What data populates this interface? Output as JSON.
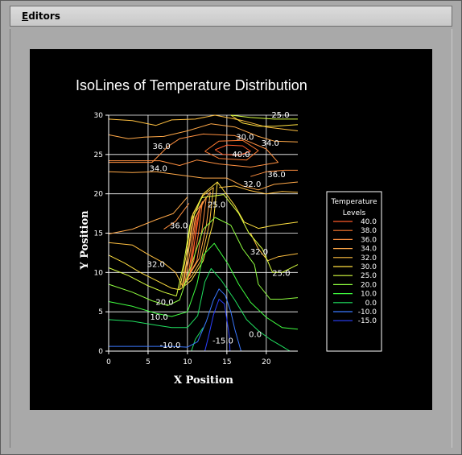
{
  "menubar": {
    "editors_label": "Editors"
  },
  "chart_data": {
    "type": "contour",
    "title": "IsoLines of Temperature Distribution",
    "xlabel": "X Position",
    "ylabel": "Y Position",
    "xlim": [
      0,
      24
    ],
    "ylim": [
      0,
      30
    ],
    "x_ticks": [
      "0",
      "5",
      "10",
      "15",
      "20"
    ],
    "y_ticks": [
      "0",
      "5",
      "10",
      "15",
      "20",
      "25",
      "30"
    ],
    "grid": true,
    "legend": {
      "title_line1": "Temperature",
      "title_line2": "Levels",
      "placement": "right",
      "levels": [
        {
          "label": "40.0",
          "color": "#ff5a28"
        },
        {
          "label": "38.0",
          "color": "#ff7a30"
        },
        {
          "label": "36.0",
          "color": "#ff9040"
        },
        {
          "label": "34.0",
          "color": "#ffa848"
        },
        {
          "label": "32.0",
          "color": "#ffc040"
        },
        {
          "label": "30.0",
          "color": "#ffe040"
        },
        {
          "label": "25.0",
          "color": "#d8ff40"
        },
        {
          "label": "20.0",
          "color": "#90ff40"
        },
        {
          "label": "10.0",
          "color": "#40ff40"
        },
        {
          "label": "0.0",
          "color": "#20e060"
        },
        {
          "label": "-10.0",
          "color": "#3a78ff"
        },
        {
          "label": "-15.0",
          "color": "#2a40ff"
        }
      ]
    },
    "contour_labels": [
      {
        "text": "25.0",
        "x": 21.8,
        "y": 30.0,
        "level": "25.0"
      },
      {
        "text": "30.0",
        "x": 17.3,
        "y": 27.2,
        "level": "30.0"
      },
      {
        "text": "34.0",
        "x": 20.5,
        "y": 26.4,
        "level": "34.0"
      },
      {
        "text": "36.0",
        "x": 6.7,
        "y": 26.0,
        "level": "36.0"
      },
      {
        "text": "40.0",
        "x": 16.8,
        "y": 25.0,
        "level": "40.0"
      },
      {
        "text": "34.0",
        "x": 6.3,
        "y": 23.2,
        "level": "34.0"
      },
      {
        "text": "36.0",
        "x": 21.3,
        "y": 22.4,
        "level": "36.0"
      },
      {
        "text": "32.0",
        "x": 18.2,
        "y": 21.2,
        "level": "32.0"
      },
      {
        "text": "25.0",
        "x": 13.7,
        "y": 18.6,
        "level": "25.0"
      },
      {
        "text": "36.0",
        "x": 8.9,
        "y": 15.9,
        "level": "36.0"
      },
      {
        "text": "32.0",
        "x": 19.1,
        "y": 12.6,
        "level": "32.0"
      },
      {
        "text": "32.0",
        "x": 6.0,
        "y": 11.0,
        "level": "32.0"
      },
      {
        "text": "25.0",
        "x": 21.9,
        "y": 9.9,
        "level": "25.0"
      },
      {
        "text": "20.0",
        "x": 7.1,
        "y": 6.2,
        "level": "20.0"
      },
      {
        "text": "10.0",
        "x": 6.4,
        "y": 4.3,
        "level": "10.0"
      },
      {
        "text": "-15.0",
        "x": 14.5,
        "y": 1.3,
        "level": "-15.0"
      },
      {
        "text": "0.0",
        "x": 18.6,
        "y": 2.1,
        "level": "0.0"
      },
      {
        "text": "-10.0",
        "x": 7.8,
        "y": 0.7,
        "level": "-10.0"
      }
    ],
    "contours": [
      {
        "level": "40.0",
        "points": [
          [
            10.3,
            9.5
          ],
          [
            10.8,
            13
          ],
          [
            11.2,
            16.5
          ],
          [
            11.6,
            18.2
          ],
          [
            11.0,
            14.5
          ],
          [
            10.5,
            11.5
          ],
          [
            10.3,
            9.5
          ]
        ]
      },
      {
        "level": "40.0",
        "points": [
          [
            13.5,
            25.6
          ],
          [
            15,
            26.2
          ],
          [
            17,
            26.1
          ],
          [
            18,
            25.4
          ],
          [
            16.5,
            24.9
          ],
          [
            14.5,
            25.0
          ],
          [
            13.5,
            25.6
          ]
        ]
      },
      {
        "level": "38.0",
        "points": [
          [
            10.0,
            9.0
          ],
          [
            10.6,
            13
          ],
          [
            11.1,
            17
          ],
          [
            11.9,
            19
          ],
          [
            11.4,
            15
          ],
          [
            10.8,
            11.5
          ],
          [
            10.0,
            9.0
          ]
        ]
      },
      {
        "level": "38.0",
        "points": [
          [
            12.2,
            25.4
          ],
          [
            14,
            26.7
          ],
          [
            17,
            26.8
          ],
          [
            19,
            25.5
          ],
          [
            17.5,
            24.3
          ],
          [
            14,
            24.5
          ],
          [
            12.2,
            25.4
          ]
        ]
      },
      {
        "level": "36.0",
        "points": [
          [
            9.7,
            8.8
          ],
          [
            10.4,
            13
          ],
          [
            11.0,
            17
          ],
          [
            12.4,
            19.6
          ],
          [
            11.9,
            15.8
          ],
          [
            11.2,
            11.5
          ],
          [
            9.7,
            8.8
          ]
        ]
      },
      {
        "level": "36.0",
        "points": [
          [
            0,
            24.0
          ],
          [
            3,
            24.0
          ],
          [
            5.5,
            24.0
          ],
          [
            7.5,
            26.0
          ],
          [
            9,
            27.0
          ],
          [
            12,
            27.6
          ],
          [
            16,
            27.4
          ],
          [
            20,
            25.7
          ],
          [
            21.5,
            24
          ],
          [
            18,
            23.4
          ],
          [
            14,
            23.8
          ],
          [
            11.2,
            24.3
          ],
          [
            9,
            23.6
          ],
          [
            6.5,
            24.2
          ],
          [
            3,
            24.2
          ],
          [
            0,
            24.2
          ]
        ]
      },
      {
        "level": "36.0",
        "points": [
          [
            7,
            15.5
          ],
          [
            8.5,
            16.5
          ],
          [
            10.2,
            18.8
          ]
        ]
      },
      {
        "level": "36.0",
        "points": [
          [
            18,
            22.2
          ],
          [
            20,
            22.8
          ],
          [
            22.3,
            23.0
          ],
          [
            24,
            23.0
          ]
        ]
      },
      {
        "level": "34.0",
        "points": [
          [
            9.5,
            8.4
          ],
          [
            10.1,
            12.5
          ],
          [
            10.9,
            17.5
          ],
          [
            12.9,
            20.2
          ],
          [
            12.4,
            16
          ],
          [
            11.5,
            11.8
          ],
          [
            9.5,
            8.4
          ]
        ]
      },
      {
        "level": "34.0",
        "points": [
          [
            0,
            27.5
          ],
          [
            2.5,
            27.0
          ],
          [
            4.5,
            27.2
          ],
          [
            7,
            27.3
          ],
          [
            10,
            28.0
          ],
          [
            13,
            28.9
          ],
          [
            16,
            28.5
          ],
          [
            19,
            27.3
          ],
          [
            21,
            26.7
          ],
          [
            24,
            26.6
          ]
        ]
      },
      {
        "level": "34.0",
        "points": [
          [
            0,
            22.8
          ],
          [
            3,
            22.7
          ],
          [
            6,
            22.8
          ],
          [
            9,
            22.4
          ],
          [
            12,
            22.0
          ],
          [
            15,
            22.0
          ],
          [
            17,
            21.0
          ],
          [
            19,
            20.5
          ],
          [
            21,
            21.2
          ],
          [
            24,
            21.5
          ]
        ]
      },
      {
        "level": "34.0",
        "points": [
          [
            0,
            14.9
          ],
          [
            3,
            15.5
          ],
          [
            6,
            16.7
          ],
          [
            8.2,
            17.5
          ],
          [
            10,
            19.6
          ]
        ]
      },
      {
        "level": "32.0",
        "points": [
          [
            9.3,
            8.2
          ],
          [
            10.0,
            12
          ],
          [
            10.7,
            17.5
          ],
          [
            12.0,
            19.8
          ],
          [
            13.3,
            20.8
          ],
          [
            12.8,
            16.2
          ],
          [
            11.7,
            11.5
          ],
          [
            10.5,
            9.5
          ],
          [
            9.3,
            8.2
          ]
        ]
      },
      {
        "level": "32.0",
        "points": [
          [
            0,
            29.5
          ],
          [
            3,
            29.3
          ],
          [
            6,
            28.7
          ],
          [
            8,
            29.4
          ],
          [
            11,
            29.5
          ],
          [
            13.5,
            30.0
          ],
          [
            17,
            29.3
          ],
          [
            20,
            28.5
          ],
          [
            24,
            28.0
          ]
        ]
      },
      {
        "level": "32.0",
        "points": [
          [
            14,
            20.8
          ],
          [
            16,
            21.0
          ],
          [
            18,
            20.4
          ],
          [
            20,
            20.0
          ],
          [
            22,
            20.3
          ],
          [
            24,
            20.2
          ]
        ]
      },
      {
        "level": "32.0",
        "points": [
          [
            0,
            13.8
          ],
          [
            3,
            13.5
          ],
          [
            5,
            12.3
          ],
          [
            7,
            11.2
          ],
          [
            8.5,
            10.0
          ],
          [
            9.3,
            8.4
          ]
        ]
      },
      {
        "level": "32.0",
        "points": [
          [
            18,
            15.0
          ],
          [
            19,
            13.0
          ],
          [
            20.2,
            11.5
          ],
          [
            21.5,
            12.0
          ],
          [
            24,
            12.4
          ]
        ]
      },
      {
        "level": "30.0",
        "points": [
          [
            9.0,
            7.8
          ],
          [
            9.8,
            12
          ],
          [
            10.5,
            17
          ],
          [
            12,
            20
          ],
          [
            13.8,
            21.5
          ],
          [
            13.3,
            16.5
          ],
          [
            12.0,
            11.5
          ],
          [
            10.5,
            9
          ],
          [
            9.0,
            7.8
          ]
        ]
      },
      {
        "level": "30.0",
        "points": [
          [
            15.5,
            30
          ],
          [
            17,
            29.0
          ],
          [
            19,
            28.6
          ],
          [
            21,
            28.6
          ],
          [
            24,
            28.8
          ]
        ]
      },
      {
        "level": "30.0",
        "points": [
          [
            13.8,
            21.5
          ],
          [
            16,
            18.5
          ],
          [
            17.2,
            16.4
          ],
          [
            19,
            15.6
          ],
          [
            21,
            16.0
          ],
          [
            24,
            16.4
          ]
        ]
      },
      {
        "level": "30.0",
        "points": [
          [
            0,
            12.2
          ],
          [
            2,
            11.2
          ],
          [
            4,
            10.0
          ],
          [
            6,
            9.0
          ],
          [
            8,
            8.0
          ],
          [
            9.0,
            7.8
          ]
        ]
      },
      {
        "level": "25.0",
        "points": [
          [
            8.6,
            7.0
          ],
          [
            9.5,
            11
          ],
          [
            10.3,
            16
          ],
          [
            11.8,
            19.5
          ],
          [
            14.6,
            19.9
          ],
          [
            16.5,
            17.5
          ],
          [
            17.8,
            15.0
          ],
          [
            19.5,
            13.0
          ],
          [
            20.8,
            10.0
          ],
          [
            22,
            10.0
          ],
          [
            24,
            11.0
          ]
        ]
      },
      {
        "level": "25.0",
        "points": [
          [
            15.5,
            30
          ],
          [
            18,
            29.7
          ],
          [
            21,
            29.5
          ],
          [
            24,
            29.5
          ]
        ]
      },
      {
        "level": "25.0",
        "points": [
          [
            0,
            10.6
          ],
          [
            2.5,
            9.6
          ],
          [
            5,
            8.3
          ],
          [
            7,
            7.5
          ],
          [
            8.6,
            7.0
          ]
        ]
      },
      {
        "level": "20.0",
        "points": [
          [
            0,
            8.5
          ],
          [
            3,
            7.5
          ],
          [
            5.5,
            6.4
          ],
          [
            7.5,
            5.8
          ],
          [
            9,
            6.5
          ],
          [
            10.5,
            11
          ],
          [
            12,
            15.5
          ],
          [
            13.5,
            17.0
          ],
          [
            15.5,
            16.0
          ],
          [
            17,
            13.0
          ],
          [
            18.5,
            11.0
          ],
          [
            19,
            8.5
          ],
          [
            20.5,
            6.6
          ],
          [
            22,
            6.6
          ],
          [
            24,
            6.8
          ]
        ]
      },
      {
        "level": "10.0",
        "points": [
          [
            0,
            6.3
          ],
          [
            3,
            5.7
          ],
          [
            6,
            4.8
          ],
          [
            8,
            4.4
          ],
          [
            10,
            5.0
          ],
          [
            11.2,
            8.5
          ],
          [
            12,
            12.2
          ],
          [
            13.4,
            13.7
          ],
          [
            15.2,
            11.0
          ],
          [
            16.5,
            8.5
          ],
          [
            18,
            6.2
          ],
          [
            20,
            4.3
          ],
          [
            22,
            3.0
          ],
          [
            24,
            2.8
          ]
        ]
      },
      {
        "level": "0.0",
        "points": [
          [
            0,
            4.0
          ],
          [
            3,
            3.8
          ],
          [
            6,
            3.3
          ],
          [
            8,
            3.0
          ],
          [
            10,
            3.0
          ],
          [
            11.3,
            4.5
          ],
          [
            12.2,
            8.8
          ],
          [
            13.0,
            10.5
          ],
          [
            14.3,
            9.0
          ],
          [
            16,
            6.5
          ],
          [
            17.5,
            4.0
          ],
          [
            19,
            2.6
          ],
          [
            20.5,
            1.5
          ],
          [
            22,
            0.6
          ],
          [
            23,
            0
          ]
        ]
      },
      {
        "level": "0.0",
        "points": [
          [
            10.5,
            0
          ],
          [
            11,
            1.5
          ],
          [
            12,
            3.0
          ]
        ]
      },
      {
        "level": "-10.0",
        "points": [
          [
            0,
            0.6
          ],
          [
            3,
            0.6
          ],
          [
            6,
            0.6
          ],
          [
            8,
            0.6
          ],
          [
            10,
            0.5
          ],
          [
            11.3,
            1.2
          ],
          [
            12.4,
            3.8
          ],
          [
            13.3,
            6.5
          ],
          [
            14.0,
            7.9
          ],
          [
            14.8,
            7.1
          ],
          [
            15.5,
            5.0
          ],
          [
            16,
            2.8
          ],
          [
            16.8,
            0
          ]
        ]
      },
      {
        "level": "-15.0",
        "points": [
          [
            12.2,
            0
          ],
          [
            12.7,
            2.0
          ],
          [
            13.3,
            4.6
          ],
          [
            14.0,
            6.6
          ],
          [
            14.7,
            6.0
          ],
          [
            15.0,
            4.0
          ],
          [
            15.3,
            2.0
          ],
          [
            15.4,
            0
          ]
        ]
      }
    ]
  }
}
